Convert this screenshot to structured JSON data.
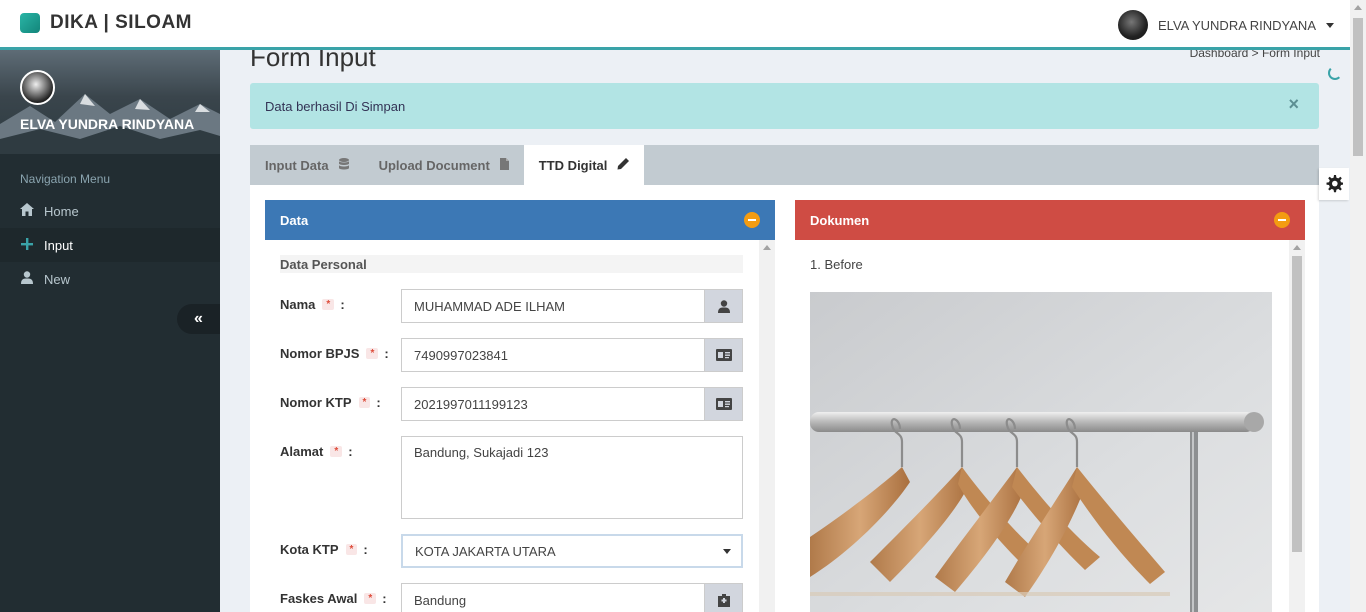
{
  "brand": {
    "name": "DIKA | SILOAM"
  },
  "topbar": {
    "user_name": "ELVA YUNDRA RINDYANA"
  },
  "sidebar": {
    "user_name": "ELVA YUNDRA RINDYANA",
    "nav_header": "Navigation Menu",
    "items": [
      {
        "label": "Home",
        "icon": "home-icon"
      },
      {
        "label": "Input",
        "icon": "plus-icon"
      },
      {
        "label": "New",
        "icon": "user-icon"
      }
    ],
    "collapse_glyph": "«"
  },
  "page": {
    "title": "Form Input",
    "breadcrumb": "Dashboard  >  Form Input"
  },
  "alert": {
    "message": "Data berhasil Di Simpan",
    "close_glyph": "×"
  },
  "tabs": [
    {
      "label": "Input Data",
      "icon": "database-icon"
    },
    {
      "label": "Upload Document",
      "icon": "file-icon"
    },
    {
      "label": "TTD Digital",
      "icon": "pencil-icon"
    }
  ],
  "data_box": {
    "title": "Data",
    "section_title": "Data Personal",
    "fields": {
      "nama": {
        "label": "Nama",
        "value": "MUHAMMAD ADE ILHAM"
      },
      "bpjs": {
        "label": "Nomor BPJS",
        "value": "7490997023841"
      },
      "ktp": {
        "label": "Nomor KTP",
        "value": "2021997011199123"
      },
      "alamat": {
        "label": "Alamat",
        "value": "Bandung, Sukajadi 123"
      },
      "kota": {
        "label": "Kota KTP",
        "value": "KOTA JAKARTA UTARA"
      },
      "faskes": {
        "label": "Faskes Awal",
        "value": "Bandung"
      }
    },
    "required_mark": "*",
    "colon": ":"
  },
  "doc_box": {
    "title": "Dokumen",
    "item_label": "1. Before"
  },
  "colors": {
    "accent": "#3aa3a8",
    "sidebar_bg": "#222d32",
    "data_header": "#3c78b5",
    "doc_header": "#cf4c44",
    "alert_bg": "#b2e4e4",
    "collapse": "#f39c12"
  }
}
